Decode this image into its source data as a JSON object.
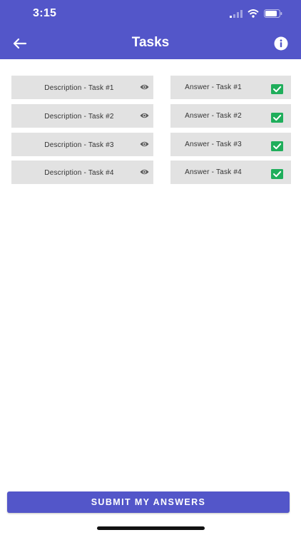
{
  "status_bar": {
    "time": "3:15"
  },
  "header": {
    "title": "Tasks"
  },
  "tasks": [
    {
      "description": "Description - Task #1",
      "answer": "Answer - Task #1",
      "answered": true
    },
    {
      "description": "Description - Task #2",
      "answer": "Answer - Task #2",
      "answered": true
    },
    {
      "description": "Description - Task #3",
      "answer": "Answer - Task #3",
      "answered": true
    },
    {
      "description": "Description - Task #4",
      "answer": "Answer - Task #4",
      "answered": true
    }
  ],
  "submit_label": "SUBMIT MY ANSWERS",
  "colors": {
    "primary": "#5356c9",
    "cell_bg": "#e2e2e2",
    "check_green": "#1fae5b"
  },
  "icons": {
    "back": "arrow-left-icon",
    "info": "info-icon",
    "view": "eye-icon",
    "answered": "checkbox-checked-icon"
  }
}
